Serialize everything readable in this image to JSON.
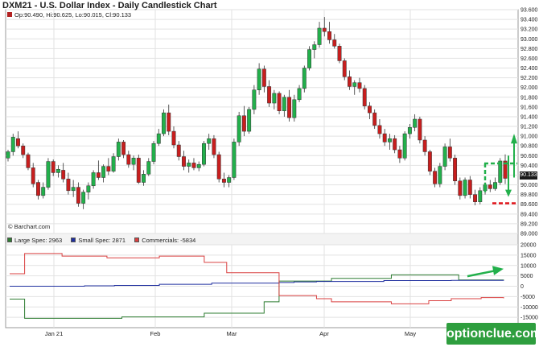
{
  "title": "DXM21 - U.S. Dollar Index - Daily Candlestick Chart",
  "ohlc_text": "Op:90.490, Hi:90.625, Lo:90.015, Cl:90.133",
  "credit": "© Barchart.com",
  "price_tag": "90.133",
  "watermark": "optionclue.com",
  "colors": {
    "up": "#22b04b",
    "down": "#c81e1e",
    "grid": "#e2e2e2",
    "large_spec": "#2e7d32",
    "small_spec": "#1f2f9f",
    "commercials": "#d94040",
    "annotation_green": "#22b04b",
    "annotation_red": "#e0151b"
  },
  "chart_data": [
    {
      "type": "candlestick",
      "title": "DXM21 - U.S. Dollar Index - Daily Candlestick Chart",
      "ylim": [
        89.0,
        93.6
      ],
      "y_ticks": [
        "89.000",
        "89.200",
        "89.400",
        "89.600",
        "89.800",
        "90.000",
        "90.200",
        "90.400",
        "90.600",
        "90.800",
        "91.000",
        "91.200",
        "91.400",
        "91.600",
        "91.800",
        "92.000",
        "92.200",
        "92.400",
        "92.600",
        "92.800",
        "93.000",
        "93.200",
        "93.400",
        "93.600"
      ],
      "x_ticks": [
        "Jan 21",
        "Feb",
        "Mar",
        "Apr",
        "May"
      ],
      "last": {
        "open": 90.49,
        "high": 90.625,
        "low": 90.015,
        "close": 90.133
      },
      "ohlc": [
        [
          90.55,
          90.72,
          90.48,
          90.68
        ],
        [
          90.68,
          91.05,
          90.6,
          90.98
        ],
        [
          90.95,
          91.1,
          90.75,
          90.8
        ],
        [
          90.8,
          90.85,
          90.55,
          90.62
        ],
        [
          90.62,
          90.66,
          90.3,
          90.35
        ],
        [
          90.35,
          90.45,
          89.95,
          90.02
        ],
        [
          90.05,
          90.1,
          89.7,
          89.78
        ],
        [
          89.78,
          90.05,
          89.72,
          89.95
        ],
        [
          89.95,
          90.55,
          89.9,
          90.48
        ],
        [
          90.48,
          90.52,
          90.18,
          90.25
        ],
        [
          90.25,
          90.4,
          90.15,
          90.32
        ],
        [
          90.3,
          90.45,
          90.05,
          90.12
        ],
        [
          90.12,
          90.25,
          89.8,
          89.88
        ],
        [
          89.88,
          90.1,
          89.75,
          89.95
        ],
        [
          89.95,
          90.05,
          89.55,
          89.62
        ],
        [
          89.62,
          89.9,
          89.5,
          89.85
        ],
        [
          89.85,
          90.05,
          89.7,
          89.98
        ],
        [
          89.98,
          90.3,
          89.92,
          90.25
        ],
        [
          90.25,
          90.5,
          90.1,
          90.15
        ],
        [
          90.15,
          90.42,
          90.05,
          90.38
        ],
        [
          90.38,
          90.55,
          90.2,
          90.28
        ],
        [
          90.28,
          90.65,
          90.25,
          90.58
        ],
        [
          90.58,
          90.95,
          90.5,
          90.88
        ],
        [
          90.88,
          90.92,
          90.55,
          90.62
        ],
        [
          90.62,
          90.7,
          90.35,
          90.42
        ],
        [
          90.42,
          90.6,
          90.3,
          90.55
        ],
        [
          90.55,
          90.62,
          90.02,
          90.05
        ],
        [
          90.05,
          90.3,
          89.98,
          90.22
        ],
        [
          90.22,
          90.55,
          90.18,
          90.48
        ],
        [
          90.48,
          90.9,
          90.42,
          90.85
        ],
        [
          90.85,
          91.15,
          90.8,
          91.05
        ],
        [
          91.05,
          91.55,
          91.0,
          91.48
        ],
        [
          91.48,
          91.65,
          91.02,
          91.1
        ],
        [
          91.1,
          91.2,
          90.75,
          90.82
        ],
        [
          90.82,
          90.9,
          90.5,
          90.58
        ],
        [
          90.58,
          90.7,
          90.3,
          90.38
        ],
        [
          90.38,
          90.52,
          90.25,
          90.45
        ],
        [
          90.45,
          90.55,
          90.3,
          90.35
        ],
        [
          90.35,
          90.48,
          90.28,
          90.42
        ],
        [
          90.42,
          90.9,
          90.38,
          90.85
        ],
        [
          90.85,
          91.05,
          90.72,
          90.95
        ],
        [
          90.95,
          91.02,
          90.55,
          90.62
        ],
        [
          90.62,
          90.68,
          90.05,
          90.12
        ],
        [
          90.12,
          90.25,
          89.95,
          90.05
        ],
        [
          90.05,
          90.2,
          89.95,
          90.15
        ],
        [
          90.15,
          90.95,
          90.1,
          90.88
        ],
        [
          90.88,
          91.5,
          90.8,
          91.42
        ],
        [
          91.42,
          91.62,
          91.0,
          91.1
        ],
        [
          91.1,
          91.6,
          91.05,
          91.55
        ],
        [
          91.55,
          92.05,
          91.45,
          91.95
        ],
        [
          91.95,
          92.5,
          91.85,
          92.38
        ],
        [
          92.38,
          92.45,
          91.9,
          92.02
        ],
        [
          92.02,
          92.15,
          91.6,
          91.68
        ],
        [
          91.68,
          91.95,
          91.55,
          91.88
        ],
        [
          91.88,
          91.92,
          91.45,
          91.52
        ],
        [
          91.52,
          91.85,
          91.4,
          91.8
        ],
        [
          91.8,
          91.95,
          91.3,
          91.38
        ],
        [
          91.38,
          91.85,
          91.3,
          91.75
        ],
        [
          91.75,
          92.05,
          91.7,
          91.98
        ],
        [
          91.98,
          92.45,
          91.9,
          92.4
        ],
        [
          92.4,
          92.85,
          92.35,
          92.78
        ],
        [
          92.78,
          92.95,
          92.6,
          92.88
        ],
        [
          92.88,
          93.35,
          92.82,
          93.22
        ],
        [
          93.22,
          93.45,
          93.05,
          93.15
        ],
        [
          93.15,
          93.35,
          92.9,
          92.98
        ],
        [
          92.98,
          93.1,
          92.8,
          92.85
        ],
        [
          92.85,
          92.9,
          92.5,
          92.55
        ],
        [
          92.55,
          92.6,
          92.15,
          92.22
        ],
        [
          92.22,
          92.35,
          91.95,
          92.02
        ],
        [
          92.02,
          92.15,
          91.85,
          92.1
        ],
        [
          92.1,
          92.2,
          91.9,
          91.98
        ],
        [
          91.98,
          92.05,
          91.55,
          91.62
        ],
        [
          91.62,
          91.7,
          91.35,
          91.48
        ],
        [
          91.48,
          91.55,
          91.15,
          91.22
        ],
        [
          91.22,
          91.35,
          90.95,
          91.05
        ],
        [
          91.05,
          91.15,
          90.8,
          90.88
        ],
        [
          90.88,
          91.05,
          90.72,
          90.95
        ],
        [
          90.95,
          91.02,
          90.65,
          90.72
        ],
        [
          90.72,
          90.8,
          90.45,
          90.55
        ],
        [
          90.55,
          91.1,
          90.5,
          91.05
        ],
        [
          91.05,
          91.25,
          90.95,
          91.18
        ],
        [
          91.18,
          91.45,
          91.1,
          91.35
        ],
        [
          91.35,
          91.4,
          90.85,
          90.92
        ],
        [
          90.92,
          91.0,
          90.6,
          90.68
        ],
        [
          90.68,
          90.72,
          90.2,
          90.28
        ],
        [
          90.28,
          90.35,
          89.95,
          90.02
        ],
        [
          90.02,
          90.45,
          89.95,
          90.38
        ],
        [
          90.38,
          90.85,
          90.3,
          90.78
        ],
        [
          90.78,
          90.95,
          90.48,
          90.55
        ],
        [
          90.55,
          90.62,
          90.0,
          90.08
        ],
        [
          90.08,
          90.15,
          89.7,
          89.78
        ],
        [
          89.78,
          90.15,
          89.72,
          90.1
        ],
        [
          90.1,
          90.18,
          89.72,
          89.8
        ],
        [
          89.8,
          89.9,
          89.58,
          89.65
        ],
        [
          89.65,
          89.95,
          89.6,
          89.88
        ],
        [
          89.88,
          90.05,
          89.8,
          90.0
        ],
        [
          90.0,
          90.1,
          89.85,
          89.92
        ],
        [
          89.92,
          90.15,
          89.88,
          90.05
        ],
        [
          90.05,
          90.55,
          90.0,
          90.49
        ],
        [
          90.49,
          90.625,
          90.015,
          90.133
        ]
      ]
    },
    {
      "type": "line",
      "title": "",
      "ylim": [
        -20000,
        20000
      ],
      "y_ticks": [
        "20000",
        "15000",
        "10000",
        "5000",
        "0",
        "-5000",
        "-10000",
        "-15000"
      ],
      "x_ticks": [
        "Jan 21",
        "Feb",
        "Mar",
        "Apr",
        "May"
      ],
      "series": [
        {
          "name": "Large Spec: 2963",
          "values": [
            -6200,
            -6200,
            -15500,
            -15500,
            -15500,
            -15500,
            -15500,
            -15500,
            -15500,
            -15500,
            -15500,
            -15500,
            -15500,
            -15500,
            -15500,
            -14800,
            -14800,
            -14800,
            -14800,
            -14800,
            -14800,
            -14800,
            -14800,
            -14800,
            -14800,
            -14800,
            -13000,
            -13000,
            -13000,
            -13000,
            -13000,
            -13000,
            -13000,
            -13000,
            -7500,
            -7500,
            2500,
            2500,
            2500,
            2500,
            2500,
            2500,
            2500,
            3800,
            3800,
            3800,
            3800,
            3800,
            3800,
            3800,
            3800,
            5500,
            5500,
            5500,
            5500,
            5500,
            5500,
            5500,
            5500,
            5500,
            3000,
            3000,
            3000,
            3000,
            3000,
            3000,
            2963
          ]
        },
        {
          "name": "Small Spec: 2871",
          "values": [
            0,
            0,
            0,
            0,
            0,
            0,
            0,
            0,
            0,
            0,
            200,
            200,
            200,
            200,
            400,
            400,
            400,
            400,
            400,
            400,
            900,
            900,
            900,
            900,
            900,
            900,
            900,
            1500,
            1500,
            1500,
            1500,
            1500,
            1500,
            1500,
            1500,
            1500,
            1800,
            1800,
            2100,
            2100,
            2100,
            2300,
            2300,
            2300,
            2300,
            2300,
            2300,
            2300,
            2300,
            2300,
            2700,
            2700,
            2700,
            2700,
            2700,
            2700,
            2700,
            2700,
            2700,
            2800,
            2800,
            2800,
            2800,
            2800,
            2800,
            2800,
            2871
          ]
        },
        {
          "name": "Commercials: -5834",
          "values": [
            6000,
            6000,
            15800,
            15800,
            15800,
            15800,
            15800,
            14500,
            14500,
            14500,
            14500,
            14500,
            14500,
            13700,
            13700,
            13700,
            13700,
            13700,
            13700,
            13700,
            14500,
            14500,
            14500,
            14500,
            14500,
            14500,
            11500,
            11500,
            11500,
            6500,
            6500,
            6500,
            6500,
            6500,
            6500,
            6500,
            -4500,
            -4500,
            -4500,
            -4500,
            -4500,
            -6000,
            -6000,
            -7500,
            -7500,
            -7500,
            -7500,
            -7500,
            -7500,
            -7500,
            -7500,
            -8500,
            -8500,
            -8500,
            -8500,
            -8500,
            -7000,
            -7000,
            -7000,
            -6000,
            -6000,
            -6000,
            -6000,
            -5500,
            -5500,
            -5500,
            -5834
          ]
        }
      ]
    }
  ]
}
